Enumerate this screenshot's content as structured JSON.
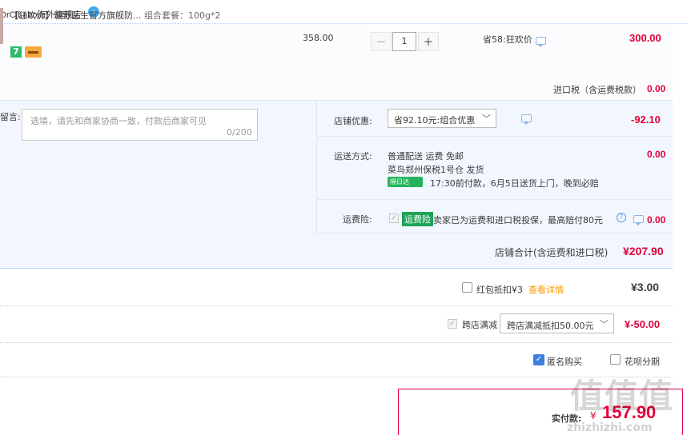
{
  "shop": {
    "name": "DrCiLabo海外旗舰店",
    "badge": "1"
  },
  "item": {
    "title": "【狂欢价】城野医生官方旗舰防...",
    "spec": "组合套餐：100g*2",
    "badge_7": "7",
    "unit_price": "358.00",
    "minus": "−",
    "quantity": "1",
    "plus": "+",
    "promo": "省58:狂欢价",
    "total": "300.00",
    "tax_label": "进口税（含运费税款）",
    "tax_value": "0.00"
  },
  "message": {
    "label": "留言:",
    "placeholder": "选填，请先和商家协商一致，付款后商家可见",
    "count": "0/200"
  },
  "store_discount": {
    "label": "店铺优惠:",
    "selected": "省92.10元:组合优惠",
    "value": "-92.10"
  },
  "shipping": {
    "label": "运送方式:",
    "line1": "普通配送 运费 免邮",
    "line2": "菜鸟郑州保税1号仓  发货",
    "badge": "隔日达",
    "line3": "17:30前付款，6月5日送货上门，晚到必赔",
    "value": "0.00"
  },
  "insurance": {
    "label": "运费险:",
    "tag": "运费险",
    "text": "卖家已为运费和进口税投保，最高赔付80元",
    "help": "?",
    "value": "0.00"
  },
  "store_total": {
    "label": "店铺合计(含运费和进口税)",
    "value": "¥207.90"
  },
  "red_packet": {
    "label": "红包抵扣¥3",
    "link": "查看详情",
    "value": "¥3.00"
  },
  "cross_store": {
    "label": "跨店满减",
    "selected": "跨店满减抵扣50.00元",
    "value": "¥-50.00"
  },
  "options": {
    "anonymous": "匿名购买",
    "huabei": "花呗分期"
  },
  "payment": {
    "label": "实付款:",
    "currency": "¥",
    "value": "157.90"
  },
  "watermark": {
    "logo": "值值值",
    "domain": "zhizhizhi.com"
  },
  "colors": {
    "price_red": "#e4003a",
    "panel_blue": "#f2f7ff",
    "checkbox_blue": "#3d7fe0",
    "green_badge": "#1fa456"
  }
}
